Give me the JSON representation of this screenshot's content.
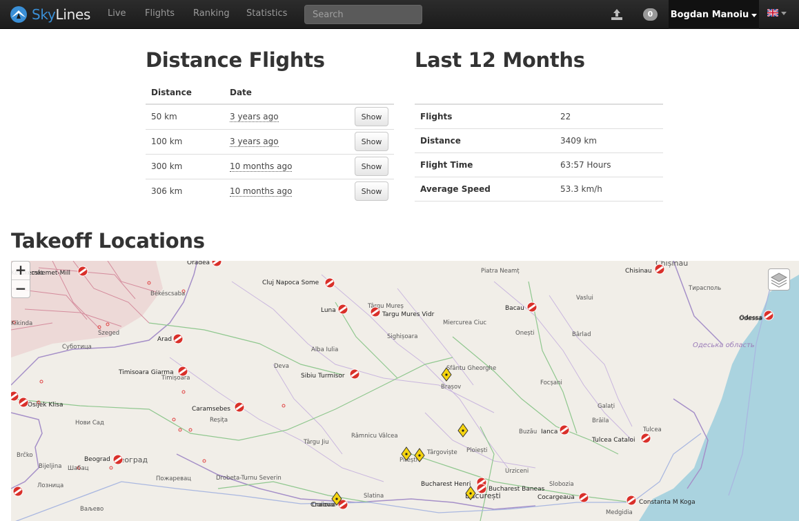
{
  "navbar": {
    "brand_sky": "Sky",
    "brand_lines": "Lines",
    "links": [
      "Live",
      "Flights",
      "Ranking",
      "Statistics"
    ],
    "search_placeholder": "Search",
    "notification_count": "0",
    "user_name": "Bogdan Manoiu"
  },
  "distance": {
    "title": "Distance Flights",
    "col_distance": "Distance",
    "col_date": "Date",
    "rows": [
      {
        "distance": "50 km",
        "date": "3 years ago",
        "action": "Show"
      },
      {
        "distance": "100 km",
        "date": "3 years ago",
        "action": "Show"
      },
      {
        "distance": "300 km",
        "date": "10 months ago",
        "action": "Show"
      },
      {
        "distance": "306 km",
        "date": "10 months ago",
        "action": "Show"
      }
    ]
  },
  "last12": {
    "title": "Last 12 Months",
    "rows": [
      {
        "label": "Flights",
        "value": "22"
      },
      {
        "label": "Distance",
        "value": "3409 km"
      },
      {
        "label": "Flight Time",
        "value": "63:57 Hours"
      },
      {
        "label": "Average Speed",
        "value": "53.3 km/h"
      }
    ]
  },
  "takeoff": {
    "title": "Takeoff Locations",
    "zoom_in": "+",
    "zoom_out": "−",
    "airports": [
      "ecskemet-Mill",
      "Oradea",
      "Cluj Napoca Some",
      "Luna",
      "Targu Mures Vidr",
      "Bacau",
      "Chisinau",
      "Odessa",
      "Arad",
      "Sibiu Turmisor",
      "Timisoara Giarma",
      "Osijek Klisa",
      "Caramsebes",
      "Ianca",
      "Tulcea Cataloi",
      "Beograd",
      "Bucharest Henri",
      "Bucharest Baneas",
      "Cocargeaua",
      "Constanta M Koga",
      "Craiova"
    ],
    "places": [
      "Chișinău",
      "Piatra Neamț",
      "Тирасполь",
      "Târgu Mureș",
      "Vaslui",
      "Miercurea Ciuc",
      "Sighișoara",
      "Onești",
      "Bârlad",
      "Odessa",
      "Одеська область",
      "Alba Iulia",
      "Deva",
      "Sfântu Gheorghe",
      "Brașov",
      "Focșani",
      "Galați",
      "Brăila",
      "Buzău",
      "Tulcea",
      "Ploiești",
      "Târgoviște",
      "Pitești",
      "Râmnicu Vâlcea",
      "Târgu Jiu",
      "Reșița",
      "Timișoara",
      "Szeged",
      "Субoтица",
      "Békéscsaba",
      "Kecskemét",
      "Нови Сад",
      "Drobeta-Turnu Severin",
      "Urziceni",
      "București",
      "Slobozia",
      "Medgidia",
      "Slatina",
      "Craiova",
      "Пожаревац",
      "Београд",
      "Шабац",
      "Bijeljina",
      "Лозница",
      "Brčko",
      "Ваљево",
      "Kikinda"
    ]
  }
}
